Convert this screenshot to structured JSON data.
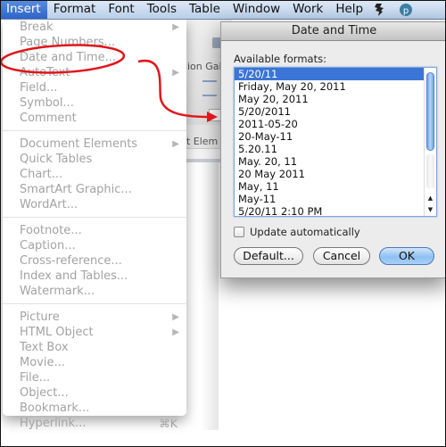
{
  "menubar": {
    "items": [
      "Insert",
      "Format",
      "Font",
      "Tools",
      "Table",
      "Window",
      "Work",
      "Help"
    ],
    "active": "Insert",
    "status_icons": [
      "script-menu-icon",
      "pinterest-icon"
    ]
  },
  "background_app": {
    "ribbon_labels": [
      "ion Gall",
      "nt Elem"
    ]
  },
  "insert_menu": {
    "groups": [
      [
        {
          "label": "Break",
          "submenu": true
        },
        {
          "label": "Page Numbers..."
        },
        {
          "label": "Date and Time...",
          "annotated": true
        },
        {
          "label": "AutoText",
          "submenu": true
        },
        {
          "label": "Field..."
        },
        {
          "label": "Symbol..."
        },
        {
          "label": "Comment"
        }
      ],
      [
        {
          "label": "Document Elements",
          "submenu": true
        },
        {
          "label": "Quick Tables"
        },
        {
          "label": "Chart..."
        },
        {
          "label": "SmartArt Graphic..."
        },
        {
          "label": "WordArt..."
        }
      ],
      [
        {
          "label": "Footnote..."
        },
        {
          "label": "Caption..."
        },
        {
          "label": "Cross-reference..."
        },
        {
          "label": "Index and Tables..."
        },
        {
          "label": "Watermark..."
        }
      ],
      [
        {
          "label": "Picture",
          "submenu": true
        },
        {
          "label": "HTML Object",
          "submenu": true
        },
        {
          "label": "Text Box"
        },
        {
          "label": "Movie..."
        },
        {
          "label": "File..."
        },
        {
          "label": "Object..."
        },
        {
          "label": "Bookmark..."
        },
        {
          "label": "Hyperlink...",
          "shortcut": "⌘K"
        }
      ]
    ]
  },
  "dialog": {
    "title": "Date and Time",
    "formats_label": "Available formats:",
    "formats": [
      "5/20/11",
      "Friday, May 20, 2011",
      "May 20, 2011",
      "5/20/2011",
      "2011-05-20",
      "20-May-11",
      "5.20.11",
      "May. 20, 11",
      "20 May 2011",
      "May, 11",
      "May-11",
      "5/20/11 2:10 PM"
    ],
    "selected_index": 0,
    "update_automatically": {
      "label": "Update automatically",
      "checked": false
    },
    "buttons": {
      "default": "Default...",
      "cancel": "Cancel",
      "ok": "OK"
    }
  },
  "colors": {
    "annotation": "#e0161b",
    "selection": "#3b75d6",
    "menubar_active": "#3a72d4",
    "disabled_text": "#a3a3a3"
  }
}
